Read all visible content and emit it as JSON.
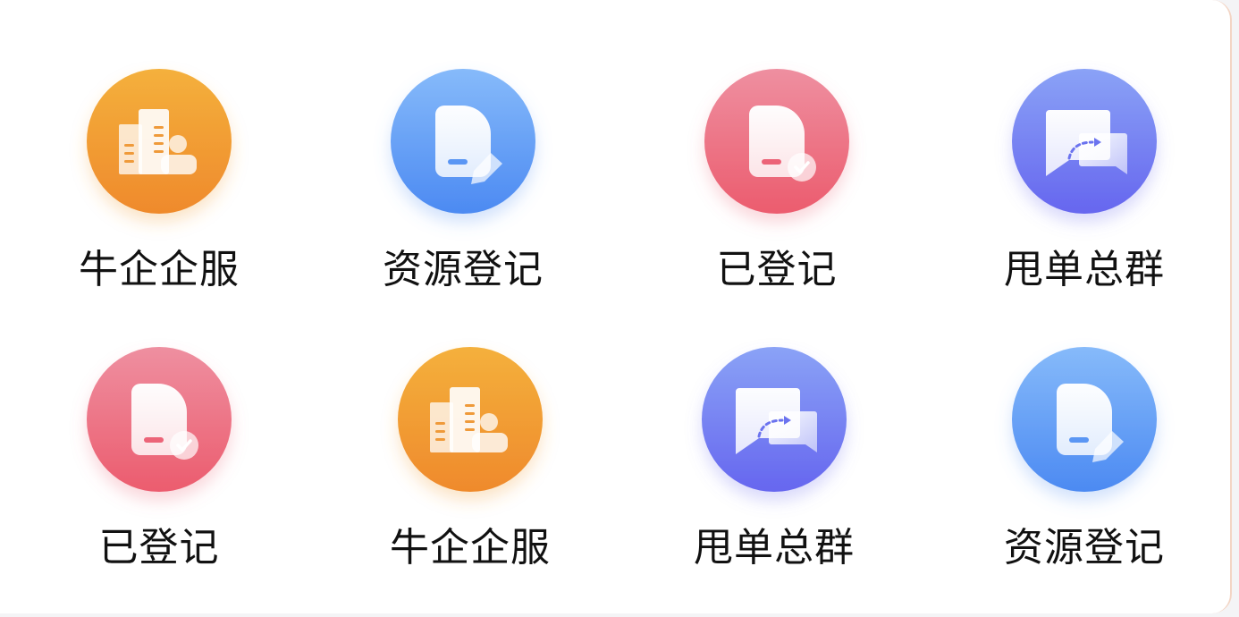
{
  "grid": {
    "rows": [
      [
        {
          "label": "牛企企服",
          "icon": "building-icon",
          "color": "orange"
        },
        {
          "label": "资源登记",
          "icon": "document-edit-icon",
          "color": "blue"
        },
        {
          "label": "已登记",
          "icon": "document-check-icon",
          "color": "red"
        },
        {
          "label": "甩单总群",
          "icon": "chat-forward-icon",
          "color": "purple"
        }
      ],
      [
        {
          "label": "已登记",
          "icon": "document-check-icon",
          "color": "red"
        },
        {
          "label": "牛企企服",
          "icon": "building-icon",
          "color": "orange"
        },
        {
          "label": "甩单总群",
          "icon": "chat-forward-icon",
          "color": "purple"
        },
        {
          "label": "资源登记",
          "icon": "document-edit-icon",
          "color": "blue"
        }
      ]
    ]
  },
  "colors": {
    "orange": [
      "#f4b03c",
      "#ef8a2c"
    ],
    "blue": [
      "#86bafa",
      "#4c8af2"
    ],
    "red": [
      "#ee8fa0",
      "#ec5c6e"
    ],
    "purple": [
      "#8aa2f6",
      "#6666ef"
    ]
  }
}
